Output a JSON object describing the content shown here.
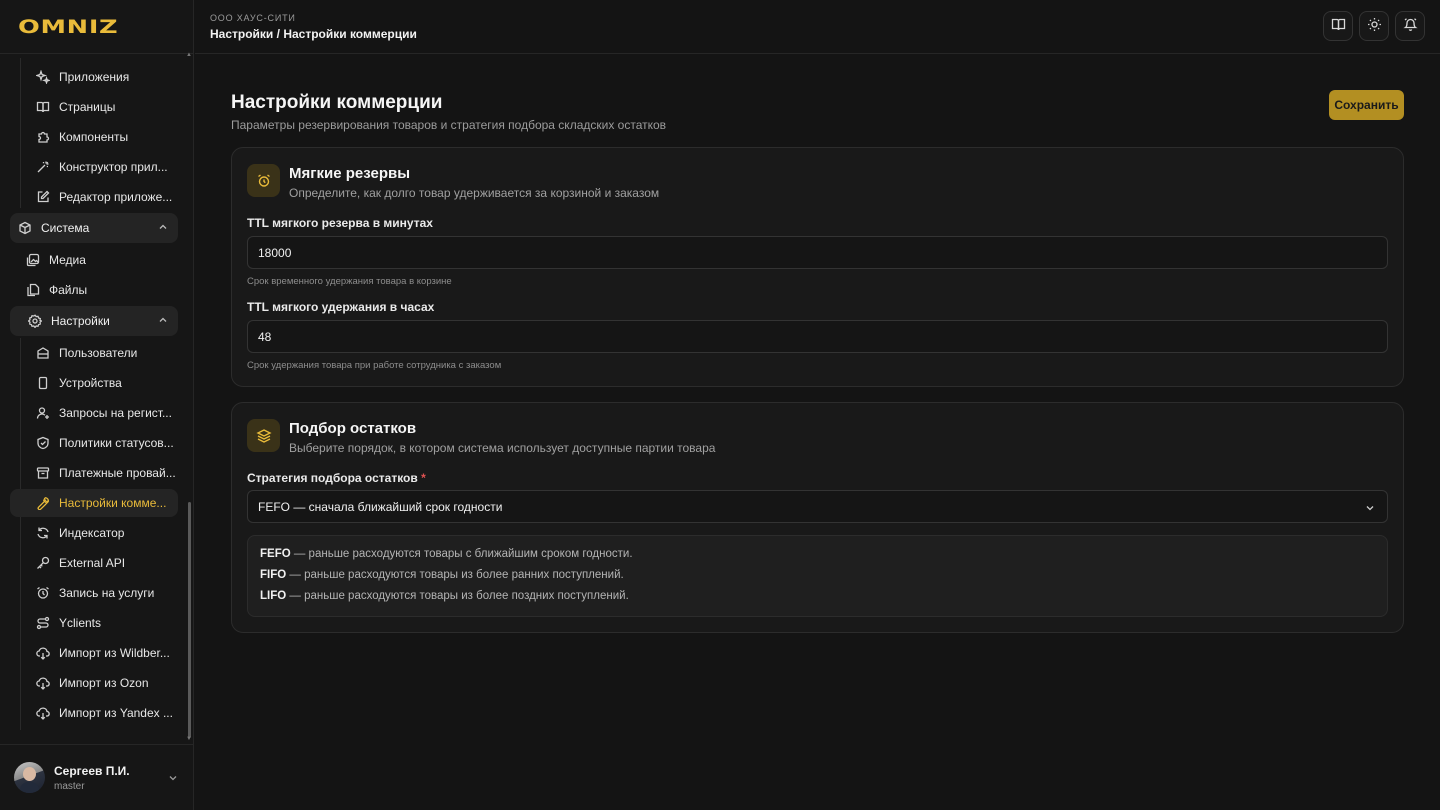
{
  "brand": {
    "logo_text": "OMNIZ",
    "accent_color": "#e9bb3a"
  },
  "header": {
    "org": "ООО ХАУС-СИТИ",
    "breadcrumb": "Настройки / Настройки коммерции",
    "buttons": [
      "book-icon",
      "sun-icon",
      "bell-icon"
    ]
  },
  "sidebar": {
    "top_items": [
      {
        "label": "Приложения",
        "icon": "sparkles-icon"
      },
      {
        "label": "Страницы",
        "icon": "book-open-icon"
      },
      {
        "label": "Компоненты",
        "icon": "puzzle-icon"
      },
      {
        "label": "Конструктор прил...",
        "icon": "wand-icon"
      },
      {
        "label": "Редактор приложе...",
        "icon": "edit-icon"
      }
    ],
    "system": {
      "label": "Система",
      "items": [
        {
          "label": "Медиа",
          "icon": "images-icon"
        },
        {
          "label": "Файлы",
          "icon": "files-icon"
        }
      ]
    },
    "settings": {
      "label": "Настройки",
      "items": [
        {
          "label": "Пользователи",
          "icon": "users-icon"
        },
        {
          "label": "Устройства",
          "icon": "device-icon"
        },
        {
          "label": "Запросы на регист...",
          "icon": "user-plus-icon"
        },
        {
          "label": "Политики статусов...",
          "icon": "shield-icon"
        },
        {
          "label": "Платежные провай...",
          "icon": "archive-icon"
        },
        {
          "label": "Настройки комме...",
          "icon": "wrench-icon",
          "active": true
        },
        {
          "label": "Индексатор",
          "icon": "refresh-icon"
        },
        {
          "label": "External API",
          "icon": "key-icon"
        },
        {
          "label": "Запись на услуги",
          "icon": "alarm-icon"
        },
        {
          "label": "Yclients",
          "icon": "route-icon"
        },
        {
          "label": "Импорт из Wildber...",
          "icon": "cloud-download-icon"
        },
        {
          "label": "Импорт из Ozon",
          "icon": "cloud-download-icon"
        },
        {
          "label": "Импорт из Yandex ...",
          "icon": "cloud-download-icon"
        }
      ]
    },
    "user": {
      "name": "Сергеев П.И.",
      "role": "master"
    }
  },
  "main": {
    "title": "Настройки коммерции",
    "subtitle": "Параметры резервирования товаров и стратегия подбора складских остатков",
    "save_label": "Сохранить",
    "soft_reserves": {
      "title": "Мягкие резервы",
      "description": "Определите, как долго товар удерживается за корзиной и заказом",
      "ttl_minutes_label": "TTL мягкого резерва в минутах",
      "ttl_minutes_value": "18000",
      "ttl_minutes_hint": "Срок временного удержания товара в корзине",
      "ttl_hours_label": "TTL мягкого удержания в часах",
      "ttl_hours_value": "48",
      "ttl_hours_hint": "Срок удержания товара при работе сотрудника с заказом"
    },
    "stock_picking": {
      "title": "Подбор остатков",
      "description": "Выберите порядок, в котором система использует доступные партии товара",
      "strategy_label": "Стратегия подбора остатков",
      "required_mark": "*",
      "strategy_value": "FEFO — сначала ближайший срок годности",
      "info": [
        {
          "term": "FEFO",
          "text": " — раньше расходуются товары с ближайшим сроком годности."
        },
        {
          "term": "FIFO",
          "text": " — раньше расходуются товары из более ранних поступлений."
        },
        {
          "term": "LIFO",
          "text": " — раньше расходуются товары из более поздних поступлений."
        }
      ]
    }
  }
}
